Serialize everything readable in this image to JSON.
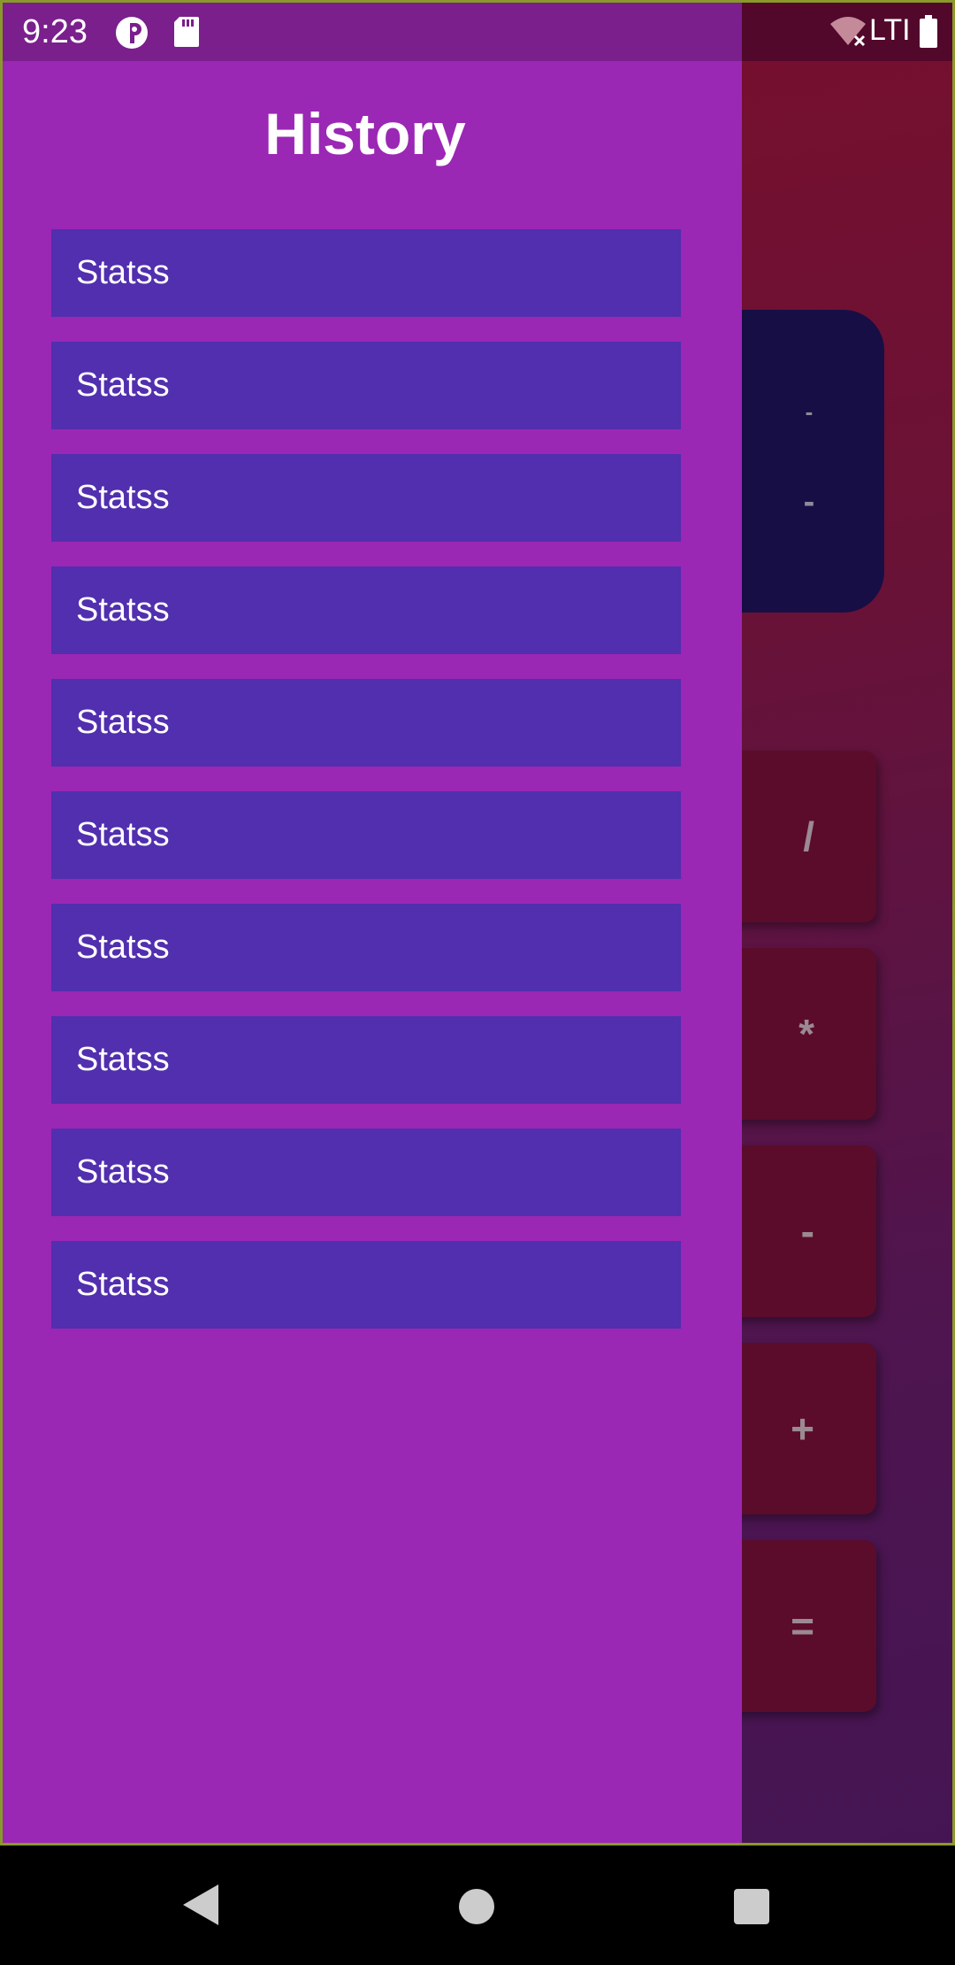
{
  "status_bar": {
    "time": "9:23",
    "network": "LTI",
    "icons": [
      "app-notification-icon",
      "sd-card-icon",
      "wifi-off-icon",
      "battery-icon"
    ]
  },
  "calculator": {
    "display": {
      "expression": "-",
      "result": "-"
    },
    "operators": [
      "/",
      "*",
      "-",
      "+",
      "="
    ]
  },
  "drawer": {
    "title": "History",
    "items": [
      {
        "label": "Statss"
      },
      {
        "label": "Statss"
      },
      {
        "label": "Statss"
      },
      {
        "label": "Statss"
      },
      {
        "label": "Statss"
      },
      {
        "label": "Statss"
      },
      {
        "label": "Statss"
      },
      {
        "label": "Statss"
      },
      {
        "label": "Statss"
      },
      {
        "label": "Statss"
      }
    ]
  },
  "nav_bar": {
    "icons": [
      "back-icon",
      "home-icon",
      "recents-icon"
    ]
  },
  "colors": {
    "drawer_bg": "#9b27b5",
    "item_bg": "#512fae",
    "display_bg": "#170e45",
    "operator_bg": "#5b0c2a"
  }
}
